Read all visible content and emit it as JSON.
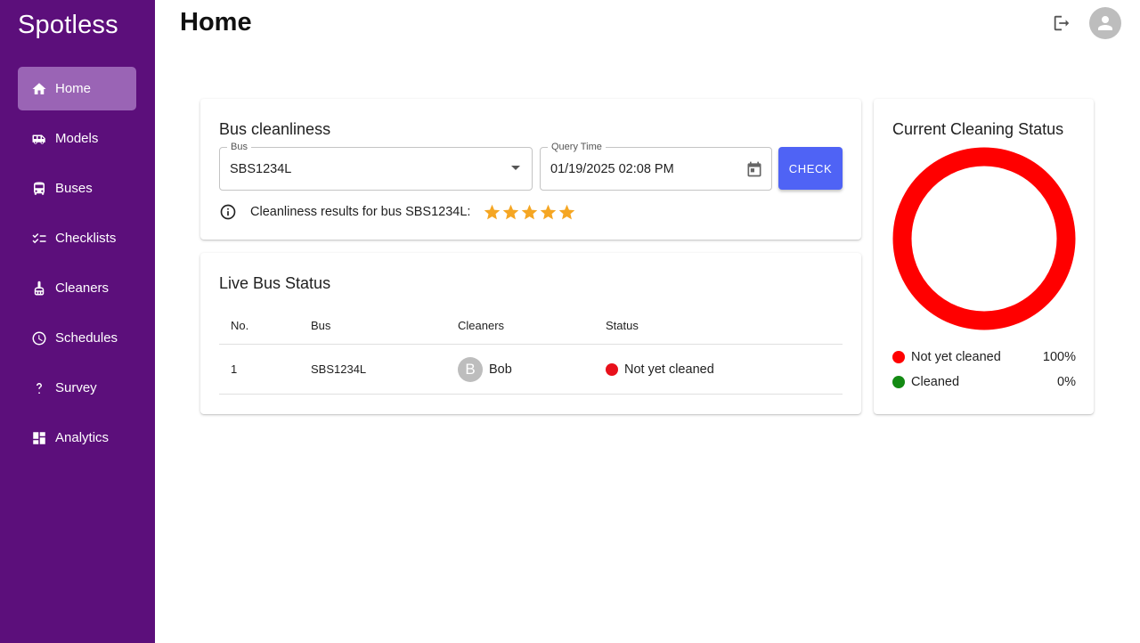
{
  "app": {
    "name": "Spotless"
  },
  "sidebar": {
    "items": [
      {
        "label": "Home",
        "icon": "home-icon",
        "active": true
      },
      {
        "label": "Models",
        "icon": "bus-side-icon"
      },
      {
        "label": "Buses",
        "icon": "bus-icon"
      },
      {
        "label": "Checklists",
        "icon": "checklist-icon"
      },
      {
        "label": "Cleaners",
        "icon": "broom-icon"
      },
      {
        "label": "Schedules",
        "icon": "clock-icon"
      },
      {
        "label": "Survey",
        "icon": "question-icon"
      },
      {
        "label": "Analytics",
        "icon": "dashboard-icon"
      }
    ]
  },
  "header": {
    "title": "Home"
  },
  "cleanliness": {
    "title": "Bus cleanliness",
    "bus_label": "Bus",
    "bus_value": "SBS1234L",
    "time_label": "Query Time",
    "time_value": "01/19/2025 02:08 PM",
    "check_label": "CHECK",
    "result_text": "Cleanliness results for bus SBS1234L:",
    "rating": 5,
    "rating_max": 5
  },
  "live": {
    "title": "Live Bus Status",
    "columns": [
      "No.",
      "Bus",
      "Cleaners",
      "Status"
    ],
    "rows": [
      {
        "no": "1",
        "bus": "SBS1234L",
        "cleaner_initial": "B",
        "cleaner": "Bob",
        "status": "Not yet cleaned",
        "status_color": "#e8111b"
      }
    ]
  },
  "status_card": {
    "title": "Current Cleaning Status",
    "legend": [
      {
        "label": "Not yet cleaned",
        "value": "100%",
        "color": "#ff0000"
      },
      {
        "label": "Cleaned",
        "value": "0%",
        "color": "#138a13"
      }
    ]
  },
  "chart_data": {
    "type": "pie",
    "title": "Current Cleaning Status",
    "categories": [
      "Not yet cleaned",
      "Cleaned"
    ],
    "values": [
      100,
      0
    ],
    "colors": [
      "#ff0000",
      "#138a13"
    ],
    "donut": true
  },
  "colors": {
    "sidebar": "#5c0f7b",
    "active_item": "#9a64b5",
    "accent": "#4f63f5",
    "star": "#f5a623"
  }
}
